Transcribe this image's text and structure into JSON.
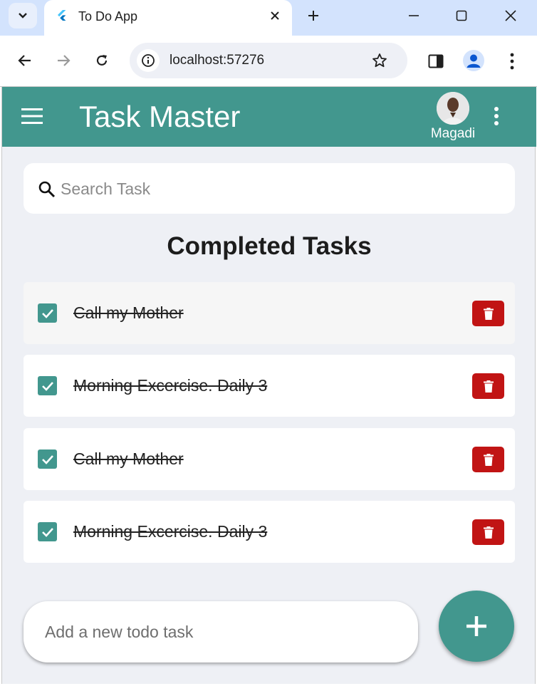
{
  "browser": {
    "tab_title": "To Do App",
    "url": "localhost:57276"
  },
  "app": {
    "title": "Task Master",
    "user_name": "Magadi",
    "search_placeholder": "Search Task",
    "section_title": "Completed Tasks",
    "tasks": [
      {
        "text": "Call my Mother",
        "completed": true
      },
      {
        "text": "Morning Excercise. Daily 3",
        "completed": true
      },
      {
        "text": "Call my Mother",
        "completed": true
      },
      {
        "text": "Morning Excercise. Daily 3",
        "completed": true
      }
    ],
    "add_placeholder": "Add a new todo task"
  },
  "colors": {
    "appbar": "#42978e",
    "delete": "#c11414",
    "background": "#eef0f5"
  },
  "icons": [
    "chevron-down-icon",
    "flutter-icon",
    "close-icon",
    "plus-icon",
    "minimize-icon",
    "maximize-icon",
    "back-icon",
    "forward-icon",
    "reload-icon",
    "info-icon",
    "star-icon",
    "side-panel-icon",
    "profile-icon",
    "more-vert-icon",
    "menu-icon",
    "search-icon",
    "check-icon",
    "trash-icon",
    "add-icon"
  ]
}
